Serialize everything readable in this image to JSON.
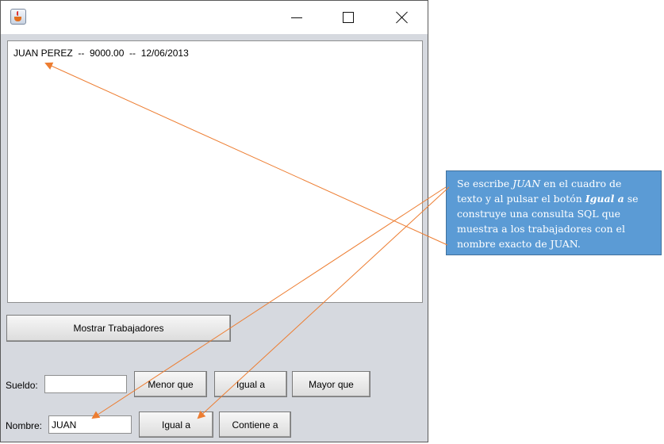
{
  "window": {
    "title": "",
    "icon": "java-cup-icon",
    "controls": [
      "minimize-icon",
      "maximize-icon",
      "close-icon"
    ]
  },
  "list": {
    "rows": [
      "JUAN PEREZ  --  9000.00  --  12/06/2013"
    ]
  },
  "buttons": {
    "mostrar": "Mostrar Trabajadores",
    "menor_que": "Menor que",
    "igual_a_sueldo": "Igual a",
    "mayor_que": "Mayor que",
    "igual_a_nombre": "Igual a",
    "contiene_a": "Contiene a"
  },
  "fields": {
    "sueldo_label": "Sueldo:",
    "sueldo_value": "",
    "nombre_label": "Nombre:",
    "nombre_value": "JUAN"
  },
  "annotation": {
    "line1_pre": "Se escribe ",
    "line1_em": "JUAN",
    "line1_post": " en el cuadro de",
    "line2_pre": "texto y al pulsar el botón ",
    "line2_strong": "Igual a",
    "line2_post": " se",
    "line3": "construye una consulta SQL que",
    "line4": "muestra a los trabajadores con el",
    "line5": "nombre exacto de JUAN.",
    "fill_color": "#5b9bd5",
    "arrow_color": "#ed7d31"
  }
}
